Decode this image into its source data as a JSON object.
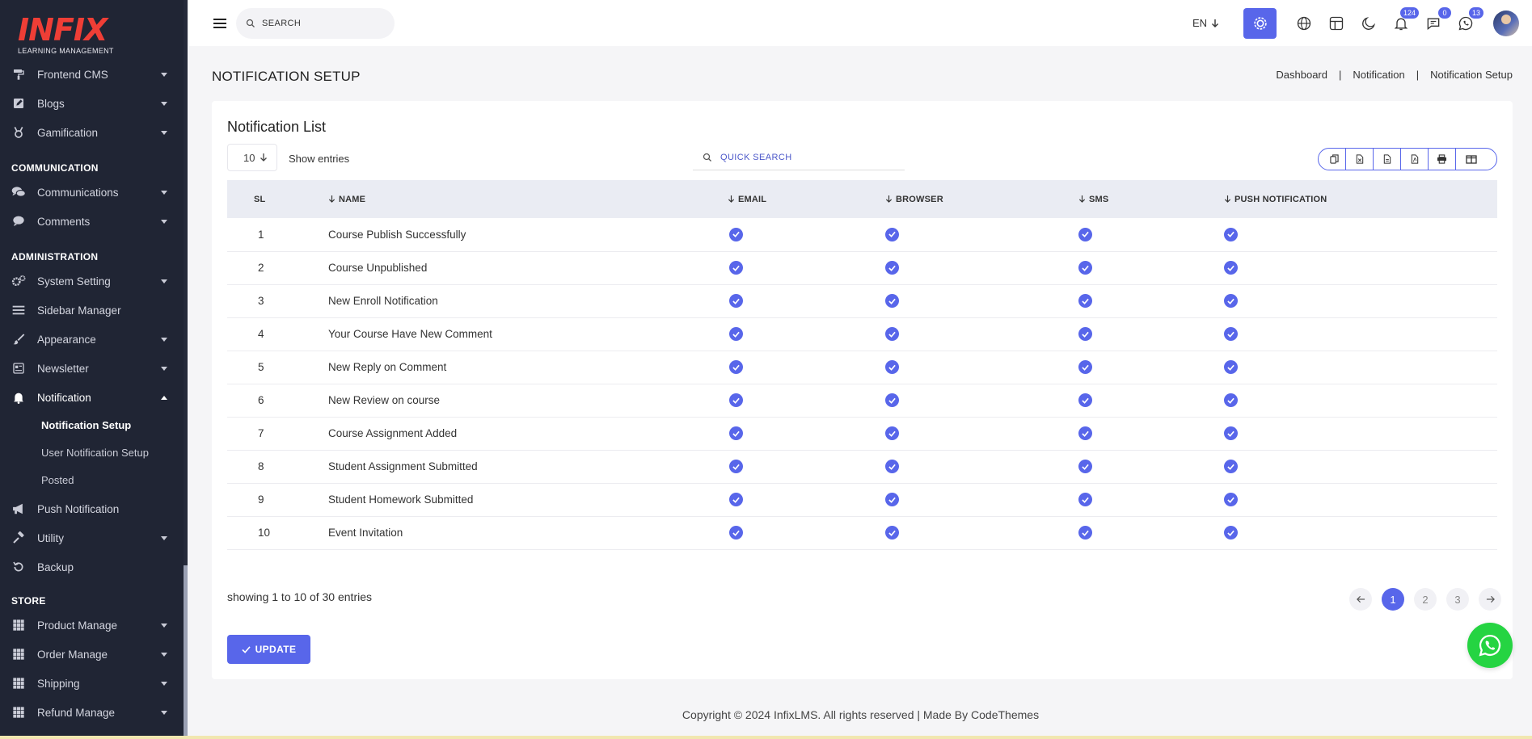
{
  "brand": {
    "logo": "INFIX",
    "tagline": "LEARNING MANAGEMENT"
  },
  "sidebar": {
    "groups": [
      {
        "items": [
          {
            "label": "Frontend CMS",
            "icon": "paint-roller-icon",
            "caret": "down"
          },
          {
            "label": "Blogs",
            "icon": "edit-icon",
            "caret": "down"
          },
          {
            "label": "Gamification",
            "icon": "medal-icon",
            "caret": "down"
          }
        ]
      },
      {
        "section": "COMMUNICATION",
        "items": [
          {
            "label": "Communications",
            "icon": "comments-icon",
            "caret": "down"
          },
          {
            "label": "Comments",
            "icon": "comment-icon",
            "caret": "down"
          }
        ]
      },
      {
        "section": "ADMINISTRATION",
        "items": [
          {
            "label": "System Setting",
            "icon": "cogs-icon",
            "caret": "down"
          },
          {
            "label": "Sidebar Manager",
            "icon": "bars-icon",
            "caret": ""
          },
          {
            "label": "Appearance",
            "icon": "brush-icon",
            "caret": "down"
          },
          {
            "label": "Newsletter",
            "icon": "newsletter-icon",
            "caret": "down"
          },
          {
            "label": "Notification",
            "icon": "bell-icon",
            "caret": "up",
            "active": true,
            "children": [
              {
                "label": "Notification Setup",
                "active": true
              },
              {
                "label": "User Notification Setup"
              },
              {
                "label": "Posted"
              }
            ]
          },
          {
            "label": "Push Notification",
            "icon": "bullhorn-icon",
            "caret": ""
          },
          {
            "label": "Utility",
            "icon": "hammer-icon",
            "caret": "down"
          },
          {
            "label": "Backup",
            "icon": "undo-icon",
            "caret": ""
          }
        ]
      },
      {
        "section": "STORE",
        "items": [
          {
            "label": "Product Manage",
            "icon": "grid-icon",
            "caret": "down"
          },
          {
            "label": "Order Manage",
            "icon": "grid-icon",
            "caret": "down"
          },
          {
            "label": "Shipping",
            "icon": "grid-icon",
            "caret": "down"
          },
          {
            "label": "Refund Manage",
            "icon": "grid-icon",
            "caret": "down"
          }
        ]
      }
    ]
  },
  "topbar": {
    "search_placeholder": "SEARCH",
    "language": "EN",
    "badges": {
      "notifications": "124",
      "messages": "0",
      "whatsapp": "13"
    }
  },
  "page": {
    "title": "NOTIFICATION SETUP",
    "breadcrumb": [
      "Dashboard",
      "Notification",
      "Notification Setup"
    ]
  },
  "card": {
    "title": "Notification List",
    "entries_value": "10",
    "show_entries_label": "Show entries",
    "quick_search_placeholder": "QUICK SEARCH"
  },
  "table": {
    "columns": [
      "SL",
      "NAME",
      "EMAIL",
      "BROWSER",
      "SMS",
      "PUSH NOTIFICATION"
    ],
    "rows": [
      {
        "sl": "1",
        "name": "Course Publish Successfully"
      },
      {
        "sl": "2",
        "name": "Course Unpublished"
      },
      {
        "sl": "3",
        "name": "New Enroll Notification"
      },
      {
        "sl": "4",
        "name": "Your Course Have New Comment"
      },
      {
        "sl": "5",
        "name": "New Reply on Comment"
      },
      {
        "sl": "6",
        "name": "New Review on course"
      },
      {
        "sl": "7",
        "name": "Course Assignment Added"
      },
      {
        "sl": "8",
        "name": "Student Assignment Submitted"
      },
      {
        "sl": "9",
        "name": "Student Homework Submitted"
      },
      {
        "sl": "10",
        "name": "Event Invitation"
      }
    ]
  },
  "footer_info": {
    "showing": "showing 1 to 10 of 30 entries",
    "pages": [
      "1",
      "2",
      "3"
    ],
    "current_page": "1",
    "update_label": "UPDATE",
    "copyright": "Copyright © 2024 InfixLMS. All rights reserved | Made By CodeThemes"
  },
  "colors": {
    "accent": "#5866ea",
    "sidebar_bg": "#202534",
    "brand_red": "#ef3e36",
    "whatsapp": "#25d442"
  }
}
